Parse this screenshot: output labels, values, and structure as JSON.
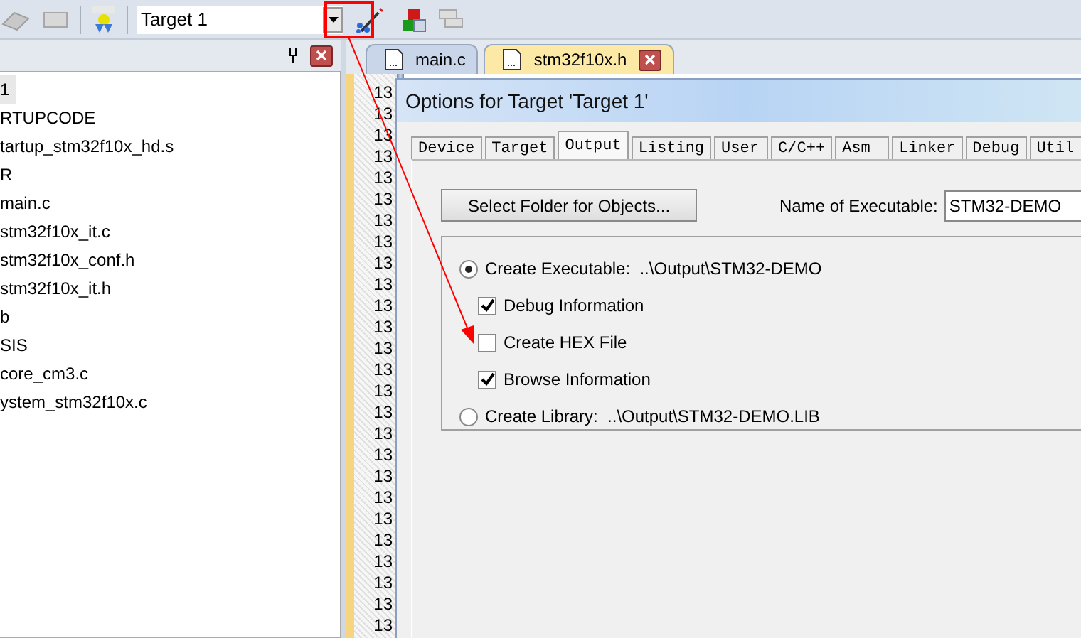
{
  "toolbar": {
    "target_select": "Target 1"
  },
  "project_panel": {
    "files": [
      {
        "name": "1",
        "selected": true
      },
      {
        "name": "RTUPCODE",
        "selected": false
      },
      {
        "name": "tartup_stm32f10x_hd.s",
        "selected": false
      },
      {
        "name": "R",
        "selected": false
      },
      {
        "name": "main.c",
        "selected": false
      },
      {
        "name": "stm32f10x_it.c",
        "selected": false
      },
      {
        "name": "stm32f10x_conf.h",
        "selected": false
      },
      {
        "name": "stm32f10x_it.h",
        "selected": false
      },
      {
        "name": "b",
        "selected": false
      },
      {
        "name": "SIS",
        "selected": false
      },
      {
        "name": "core_cm3.c",
        "selected": false
      },
      {
        "name": "ystem_stm32f10x.c",
        "selected": false
      }
    ]
  },
  "editor_tabs": [
    {
      "label": "main.c",
      "selected": false
    },
    {
      "label": "stm32f10x.h",
      "selected": true
    }
  ],
  "line_numbers": [
    "13",
    "13",
    "13",
    "13",
    "13",
    "13",
    "13",
    "13",
    "13",
    "13",
    "13",
    "13",
    "13",
    "13",
    "13",
    "13",
    "13",
    "13",
    "13",
    "13",
    "13",
    "13",
    "13",
    "13",
    "13",
    "13"
  ],
  "dialog": {
    "title": "Options for Target 'Target 1'",
    "tabs": [
      {
        "label": "Device",
        "selected": false
      },
      {
        "label": "Target",
        "selected": false
      },
      {
        "label": "Output",
        "selected": true
      },
      {
        "label": "Listing",
        "selected": false
      },
      {
        "label": "User",
        "selected": false
      },
      {
        "label": "C/C++",
        "selected": false
      },
      {
        "label": "Asm",
        "selected": false
      },
      {
        "label": "Linker",
        "selected": false
      },
      {
        "label": "Debug",
        "selected": false
      },
      {
        "label": "Util",
        "selected": false
      }
    ],
    "select_folder_button": "Select Folder for Objects...",
    "name_label": "Name of Executable:",
    "name_value": "STM32-DEMO",
    "options": [
      {
        "kind": "radio",
        "label": "Create Executable:  ..\\Output\\STM32-DEMO",
        "checked": true
      },
      {
        "kind": "checkbox",
        "label": "Debug Information",
        "checked": true
      },
      {
        "kind": "checkbox",
        "label": "Create HEX File",
        "checked": false
      },
      {
        "kind": "checkbox",
        "label": "Browse Information",
        "checked": true
      },
      {
        "kind": "radio",
        "label": "Create Library:  ..\\Output\\STM32-DEMO.LIB",
        "checked": false
      }
    ]
  }
}
